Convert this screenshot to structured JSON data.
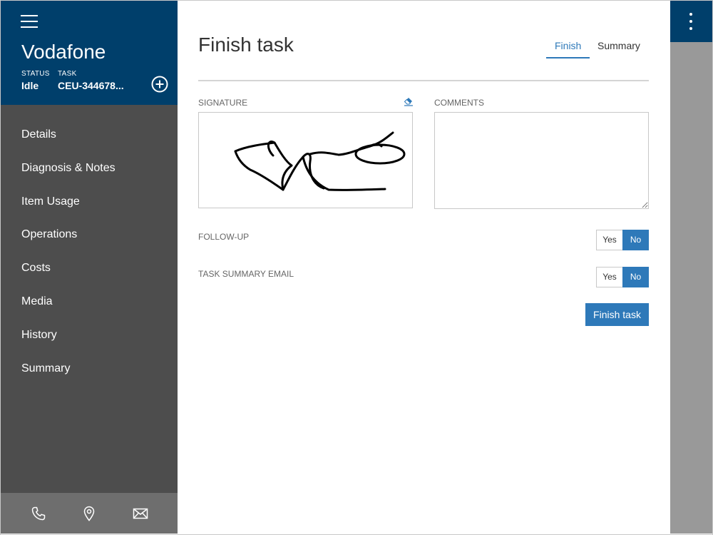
{
  "sidebar": {
    "brand": "Vodafone",
    "status_label": "STATUS",
    "status_value": "Idle",
    "task_label": "TASK",
    "task_value": "CEU-344678...",
    "items": [
      {
        "label": "Details"
      },
      {
        "label": "Diagnosis & Notes"
      },
      {
        "label": "Item Usage"
      },
      {
        "label": "Operations"
      },
      {
        "label": "Costs"
      },
      {
        "label": "Media"
      },
      {
        "label": "History"
      },
      {
        "label": "Summary"
      }
    ],
    "footer_icons": [
      "phone-icon",
      "location-pin-icon",
      "mail-icon"
    ]
  },
  "main": {
    "title": "Finish task",
    "tabs": [
      {
        "label": "Finish",
        "active": true
      },
      {
        "label": "Summary",
        "active": false
      }
    ],
    "signature_label": "SIGNATURE",
    "comments_label": "COMMENTS",
    "comments_value": "",
    "follow_up": {
      "label": "FOLLOW-UP",
      "yes": "Yes",
      "no": "No",
      "selected": "No"
    },
    "summary_email": {
      "label": "TASK SUMMARY EMAIL",
      "yes": "Yes",
      "no": "No",
      "selected": "No"
    },
    "finish_button": "Finish task"
  },
  "colors": {
    "header_blue": "#003f6b",
    "accent_blue": "#2e79b9",
    "sidebar_gray": "#4d4d4d",
    "rail_gray": "#999999"
  }
}
